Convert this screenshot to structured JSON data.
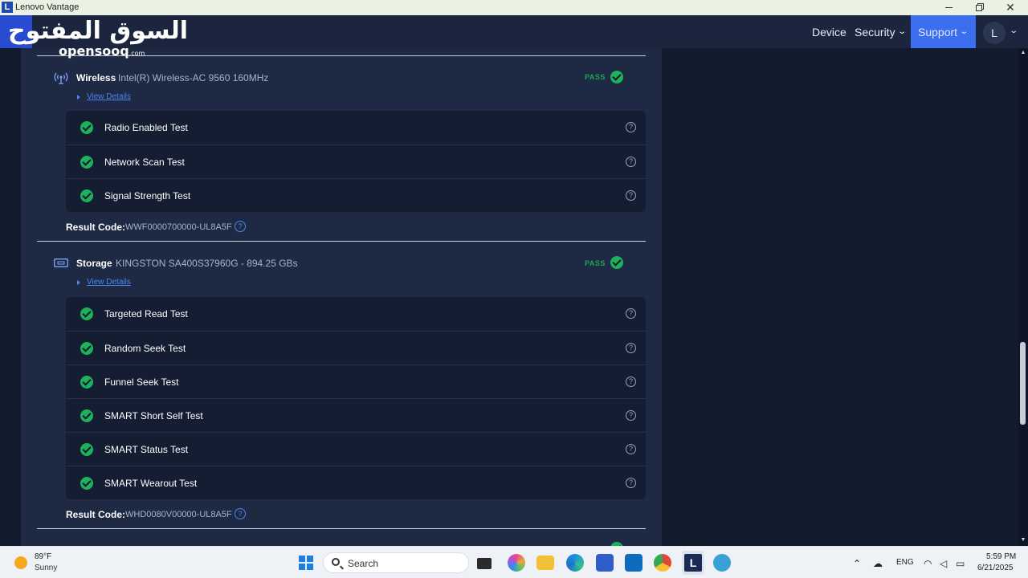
{
  "window": {
    "title": "Lenovo Vantage",
    "app_letter": "L"
  },
  "watermark": {
    "arabic": "السوق المفتوح",
    "latin": "opensooq",
    "suffix": ".com"
  },
  "nav": {
    "device": "Device",
    "security": "Security",
    "support": "Support",
    "avatar": "L"
  },
  "sections": [
    {
      "title": "Wireless",
      "desc": "Intel(R) Wireless-AC 9560 160MHz",
      "status": "PASS",
      "view_details": "View Details",
      "tests": [
        "Radio Enabled Test",
        "Network Scan Test",
        "Signal Strength Test"
      ],
      "result_label": "Result Code:",
      "result_code": "WWF0000700000-UL8A5F"
    },
    {
      "title": "Storage",
      "desc": "KINGSTON SA400S37960G - 894.25 GBs",
      "status": "PASS",
      "view_details": "View Details",
      "tests": [
        "Targeted Read Test",
        "Random Seek Test",
        "Funnel Seek Test",
        "SMART Short Self Test",
        "SMART Status Test",
        "SMART Wearout Test"
      ],
      "result_label": "Result Code:",
      "result_code": "WHD0080V00000-UL8A5F"
    }
  ],
  "help_glyph": "?",
  "taskbar": {
    "weather_temp": "89°F",
    "weather_cond": "Sunny",
    "search": "Search",
    "lenovo_letter": "L",
    "language": "ENG",
    "time": "5:59 PM",
    "date": "6/21/2025"
  },
  "colors": {
    "accent": "#3b6ff0",
    "pass": "#1fa456",
    "background": "#121a2e",
    "panel": "#1e2a44"
  }
}
